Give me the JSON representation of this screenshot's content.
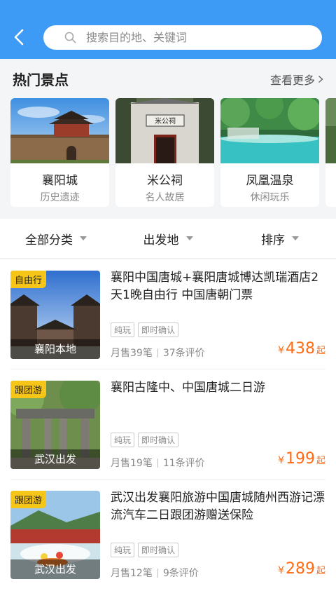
{
  "header": {
    "search_placeholder": "搜索目的地、关键词"
  },
  "hot": {
    "title": "热门景点",
    "see_more": "查看更多",
    "spots": [
      {
        "name": "襄阳城",
        "tag": "历史遗迹"
      },
      {
        "name": "米公祠",
        "tag": "名人故居",
        "plaque": "米公祠"
      },
      {
        "name": "凤凰温泉",
        "tag": "休闲玩乐"
      }
    ]
  },
  "filters": [
    {
      "label": "全部分类"
    },
    {
      "label": "出发地"
    },
    {
      "label": "排序"
    }
  ],
  "products": [
    {
      "badge": "自由行",
      "origin": "襄阳本地",
      "title": "襄阳中国唐城+襄阳唐城博达凯瑞酒店2天1晚自由行 中国唐朝门票",
      "tags": [
        "纯玩",
        "即时确认"
      ],
      "sold": "月售39笔",
      "reviews": "37条评价",
      "currency": "¥",
      "price": "438",
      "price_suffix": "起"
    },
    {
      "badge": "跟团游",
      "origin": "武汉出发",
      "title": "襄阳古隆中、中国唐城二日游",
      "tags": [
        "纯玩",
        "即时确认"
      ],
      "sold": "月售19笔",
      "reviews": "11条评价",
      "currency": "¥",
      "price": "199",
      "price_suffix": "起"
    },
    {
      "badge": "跟团游",
      "origin": "武汉出发",
      "title": "武汉出发襄阳旅游中国唐城随州西游记漂流汽车二日跟团游赠送保险",
      "tags": [
        "纯玩",
        "即时确认"
      ],
      "sold": "月售12笔",
      "reviews": "9条评价",
      "currency": "¥",
      "price": "289",
      "price_suffix": "起"
    }
  ],
  "colors": {
    "header": "#3d9af5",
    "price": "#ff6a13",
    "badge": "#f5c518"
  }
}
